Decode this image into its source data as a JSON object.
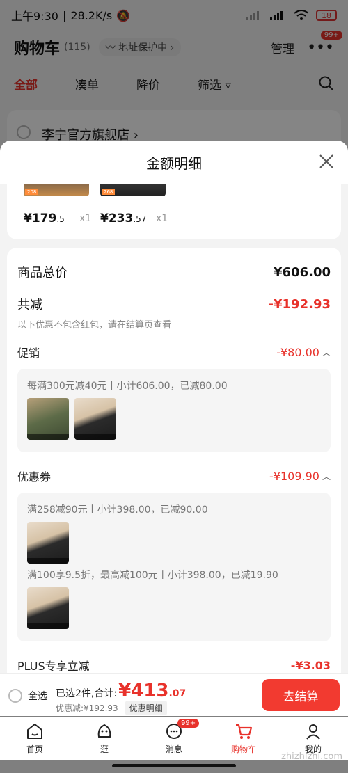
{
  "status_bar": {
    "time": "上午9:30",
    "speed": "28.2K/s",
    "battery": "18"
  },
  "header": {
    "title": "购物车",
    "count": "(115)",
    "address": "地址保护中",
    "manage": "管理",
    "more_badge": "99+"
  },
  "tabs": [
    "全部",
    "凑单",
    "降价",
    "筛选"
  ],
  "store": {
    "name": "李宁官方旗舰店"
  },
  "sheet": {
    "title": "金额明细",
    "products": [
      {
        "price_int": "¥179",
        "price_dec": ".5",
        "qty": "x1",
        "tag": "208"
      },
      {
        "price_int": "¥233",
        "price_dec": ".57",
        "qty": "x1",
        "tag": "268"
      }
    ],
    "total_label": "商品总价",
    "total_value": "¥606.00",
    "discount_label": "共减",
    "discount_value": "-¥192.93",
    "discount_note": "以下优惠不包含红包，请在结算页查看",
    "promo": {
      "label": "促销",
      "value": "-¥80.00",
      "desc": "每满300元减40元丨小计606.00，已减80.00"
    },
    "coupon": {
      "label": "优惠券",
      "value": "-¥109.90",
      "desc1": "满258减90元丨小计398.00，已减90.00",
      "desc2": "满100享9.5折，最高减100元丨小计398.00，已减19.90"
    },
    "plus": {
      "label": "PLUS专享立减",
      "value": "-¥3.03"
    }
  },
  "checkout": {
    "select_all": "全选",
    "selected": "已选2件,合计:",
    "total_int": "¥413",
    "total_dec": ".07",
    "discount": "优惠减:¥192.93",
    "detail": "优惠明细",
    "button": "去结算"
  },
  "nav": [
    {
      "label": "首页",
      "icon": "home-icon"
    },
    {
      "label": "逛",
      "icon": "browse-icon"
    },
    {
      "label": "消息",
      "icon": "message-icon",
      "badge": "99+"
    },
    {
      "label": "购物车",
      "icon": "cart-icon"
    },
    {
      "label": "我的",
      "icon": "profile-icon"
    }
  ],
  "watermark": "zhizhizhi.com",
  "colors": {
    "accent": "#e8322b",
    "button": "#f23a30"
  }
}
